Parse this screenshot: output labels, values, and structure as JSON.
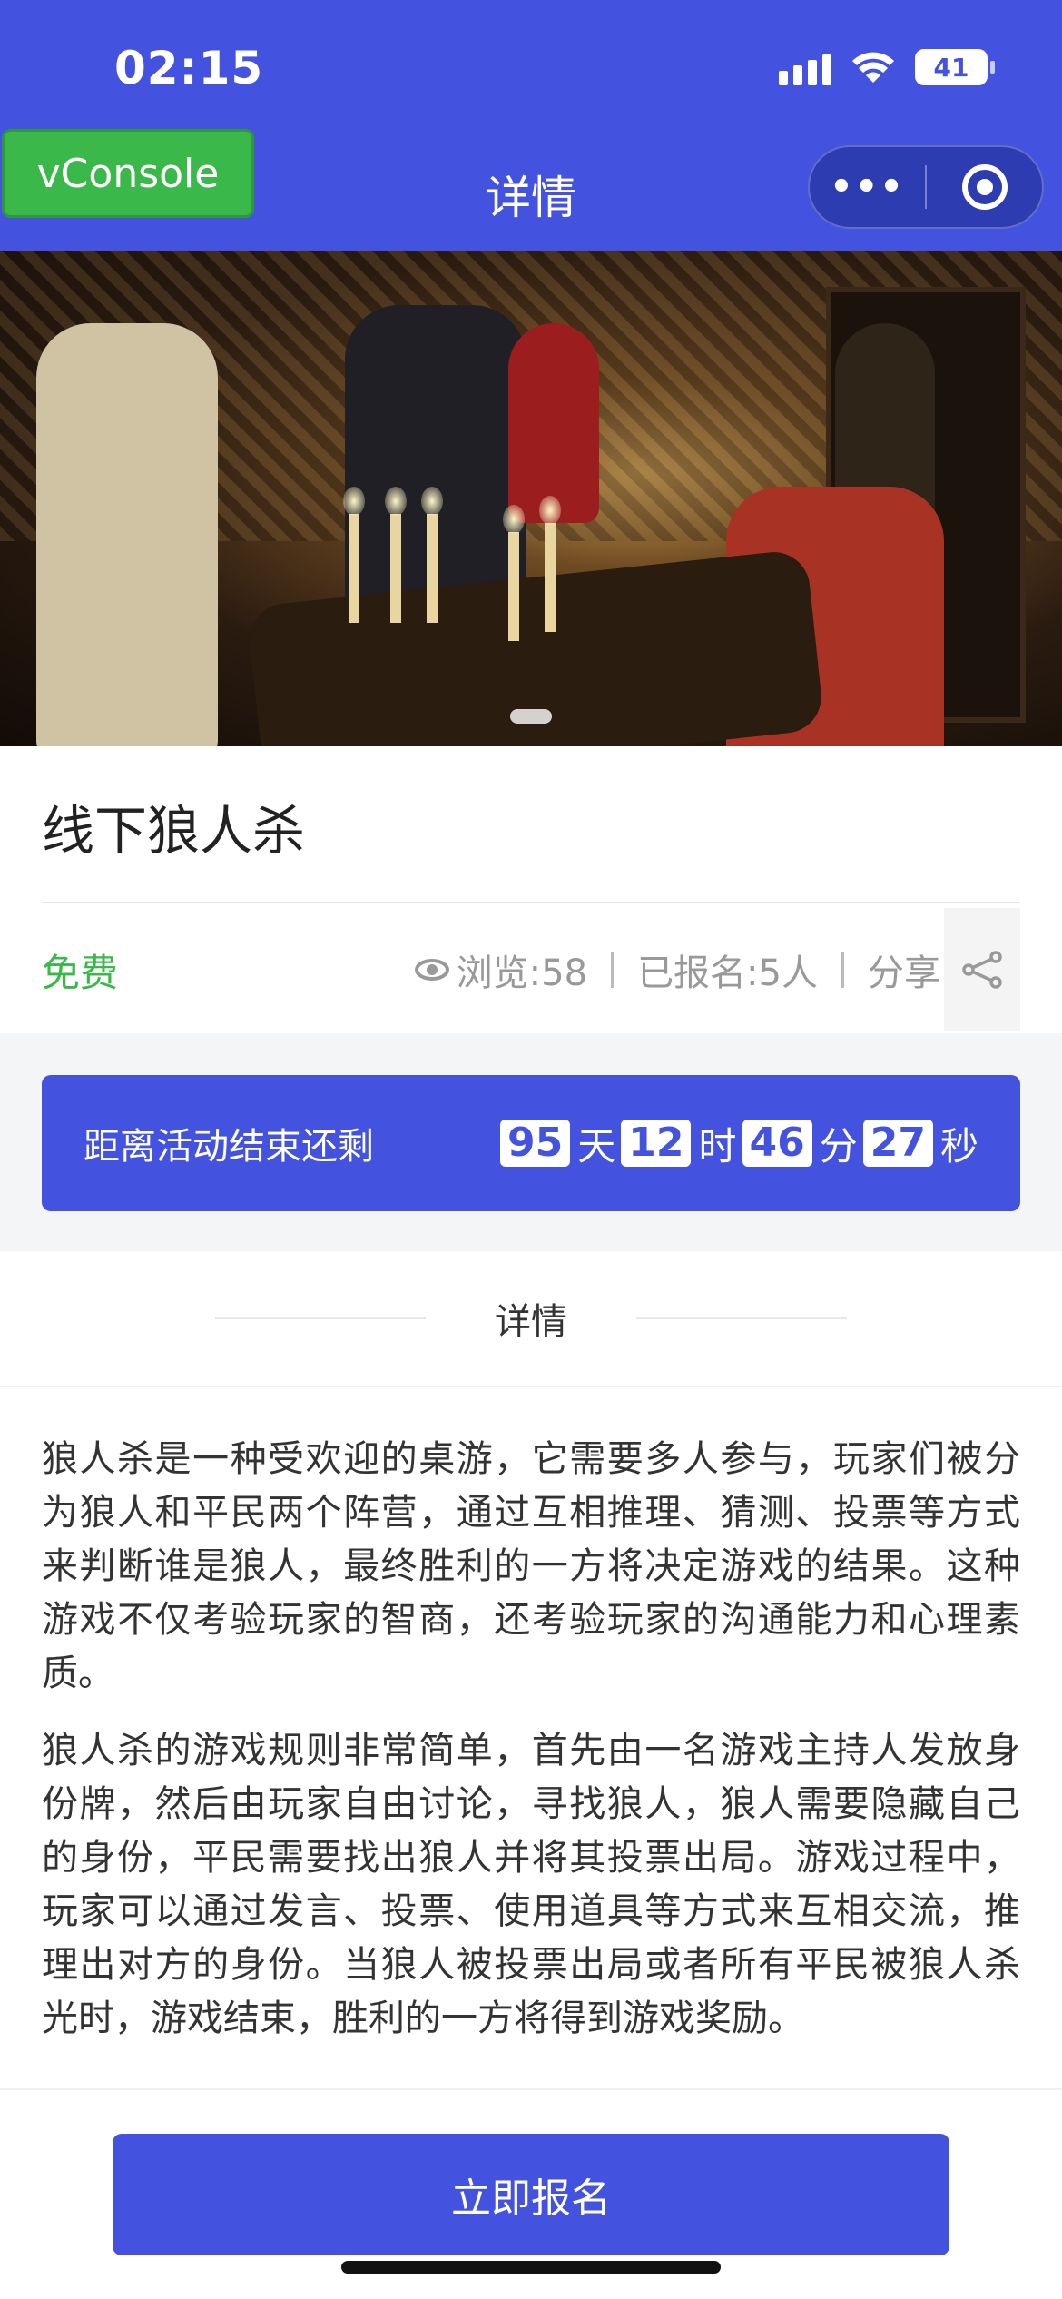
{
  "status": {
    "time": "02:15",
    "battery": "41"
  },
  "nav": {
    "vconsole": "vConsole",
    "title": "详情",
    "more_label": "•••"
  },
  "event": {
    "title": "线下狼人杀",
    "price": "免费",
    "views_label": "浏览:58",
    "signed_label": "已报名:5人",
    "share_label": "分享"
  },
  "countdown": {
    "label": "距离活动结束还剩",
    "days": "95",
    "days_unit": "天",
    "hours": "12",
    "hours_unit": "时",
    "minutes": "46",
    "minutes_unit": "分",
    "seconds": "27",
    "seconds_unit": "秒"
  },
  "section": {
    "title": "详情"
  },
  "content": {
    "p1": "狼人杀是一种受欢迎的桌游，它需要多人参与，玩家们被分为狼人和平民两个阵营，通过互相推理、猜测、投票等方式来判断谁是狼人，最终胜利的一方将决定游戏的结果。这种游戏不仅考验玩家的智商，还考验玩家的沟通能力和心理素质。",
    "p2": "狼人杀的游戏规则非常简单，首先由一名游戏主持人发放身份牌，然后由玩家自由讨论，寻找狼人，狼人需要隐藏自己的身份，平民需要找出狼人并将其投票出局。游戏过程中，玩家可以通过发言、投票、使用道具等方式来互相交流，推理出对方的身份。当狼人被投票出局或者所有平民被狼人杀光时，游戏结束，胜利的一方将得到游戏奖励。"
  },
  "action": {
    "signup_label": "立即报名"
  },
  "colors": {
    "brand": "#4353E0",
    "free": "#3BB84A",
    "vconsole": "#3BB84A"
  },
  "icons": {
    "views": "eye-icon",
    "share": "share-icon",
    "menu": "more-icon",
    "close": "target-icon"
  }
}
